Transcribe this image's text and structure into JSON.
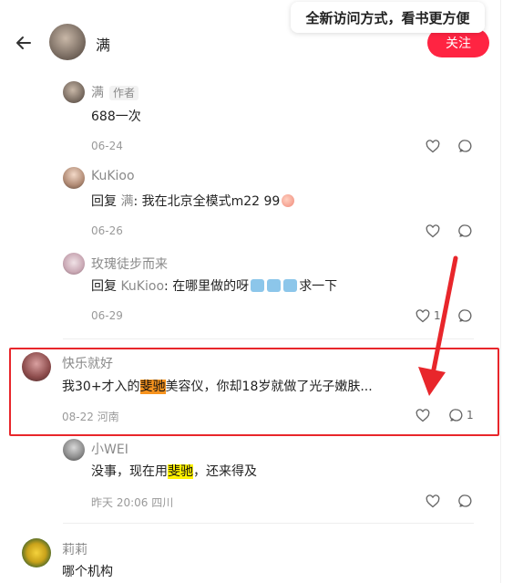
{
  "header": {
    "author_name": "满",
    "follow_label": "关注",
    "banner_text": "全新访问方式，看书更方便"
  },
  "colors": {
    "accent": "#ff2442",
    "highlight_orange": "#f7931e",
    "highlight_yellow": "#fff200",
    "annotation_red": "#e8262b"
  },
  "comments": [
    {
      "user": "满",
      "tag": "作者",
      "text": "688一次",
      "date": "06-24",
      "location": ""
    },
    {
      "user": "KuKioo",
      "reply_prefix": "回复 ",
      "reply_to": "满",
      "reply_sep": ": ",
      "text": "我在北京全模式m22 99",
      "date": "06-26"
    },
    {
      "user": "玫瑰徒步而来",
      "reply_prefix": "回复 ",
      "reply_to": "KuKioo",
      "reply_sep": ": ",
      "text_before": "在哪里做的呀",
      "text_after": "求一下",
      "date": "06-29",
      "like_count": "1"
    },
    {
      "user": "快乐就好",
      "text_a": "我30+才入的",
      "text_hl": "斐驰",
      "text_b": "美容仪，你却18岁就做了光子嫩肤...",
      "date": "08-22",
      "location": "河南",
      "comment_count": "1"
    },
    {
      "user": "小WEI",
      "text_a": "没事，现在用",
      "text_hl": "斐驰",
      "text_b": "，还来得及",
      "date": "昨天 20:06",
      "location": "四川"
    },
    {
      "user": "莉莉",
      "text": "哪个机构"
    }
  ]
}
